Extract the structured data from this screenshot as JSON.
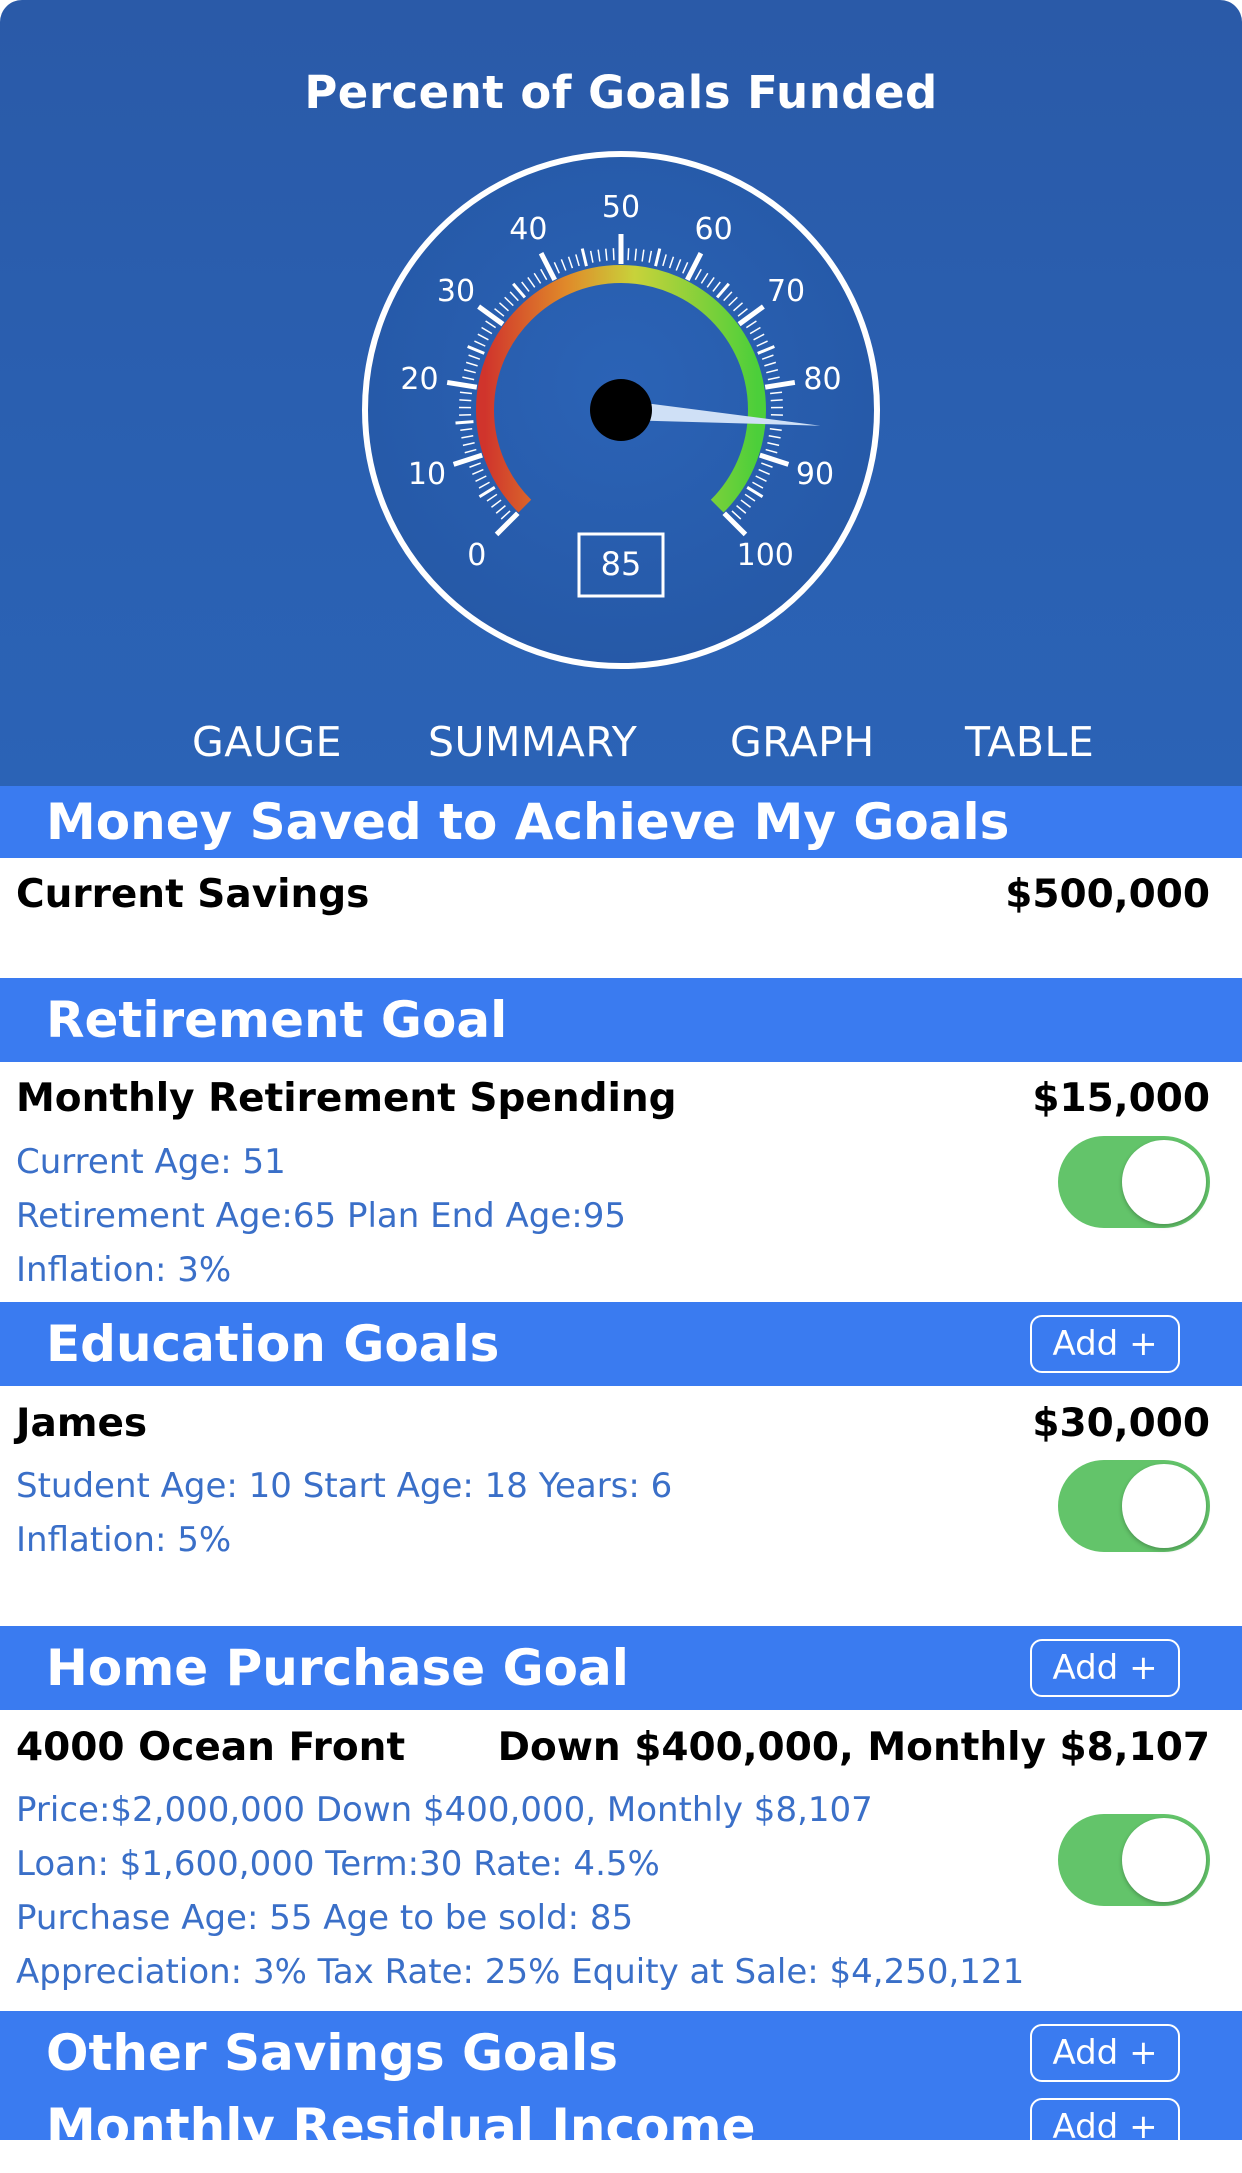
{
  "gauge": {
    "title": "Percent of Goals Funded",
    "value": 85,
    "value_display": "85",
    "scale_labels": [
      "0",
      "10",
      "20",
      "30",
      "40",
      "50",
      "60",
      "70",
      "80",
      "90",
      "100"
    ],
    "min": 0,
    "max": 100
  },
  "tabs": [
    {
      "label": "GAUGE"
    },
    {
      "label": "SUMMARY"
    },
    {
      "label": "GRAPH"
    },
    {
      "label": "TABLE"
    }
  ],
  "savings": {
    "header": "Money Saved to Achieve My Goals",
    "label": "Current Savings",
    "amount": "$500,000"
  },
  "retirement": {
    "header": "Retirement Goal",
    "label": "Monthly Retirement Spending",
    "amount": "$15,000",
    "details": [
      "Current Age: 51",
      "Retirement Age:65 Plan End Age:95",
      "Inflation: 3%"
    ],
    "enabled": true
  },
  "education": {
    "header": "Education Goals",
    "add_label": "Add +",
    "name": "James",
    "amount": "$30,000",
    "details": [
      "Student Age: 10 Start Age: 18 Years: 6",
      "Inflation: 5%"
    ],
    "enabled": true
  },
  "home": {
    "header": "Home Purchase Goal",
    "add_label": "Add +",
    "name": "4000  Ocean Front",
    "summary": "Down $400,000, Monthly $8,107",
    "details": [
      "Price:$2,000,000 Down $400,000, Monthly $8,107",
      "Loan: $1,600,000 Term:30 Rate: 4.5%",
      "Purchase Age: 55 Age to be sold: 85",
      "Appreciation: 3% Tax Rate: 25% Equity at Sale: $4,250,121"
    ],
    "enabled": true
  },
  "other": {
    "header": "Other Savings Goals",
    "add_label": "Add +"
  },
  "residual": {
    "header": "Monthly Residual Income",
    "add_label": "Add +"
  },
  "colors": {
    "header_bg": "#3a7bf0",
    "hero_bg": "#2a5fb0",
    "detail_text": "#3a6fc8",
    "toggle_on": "#63c46a"
  }
}
